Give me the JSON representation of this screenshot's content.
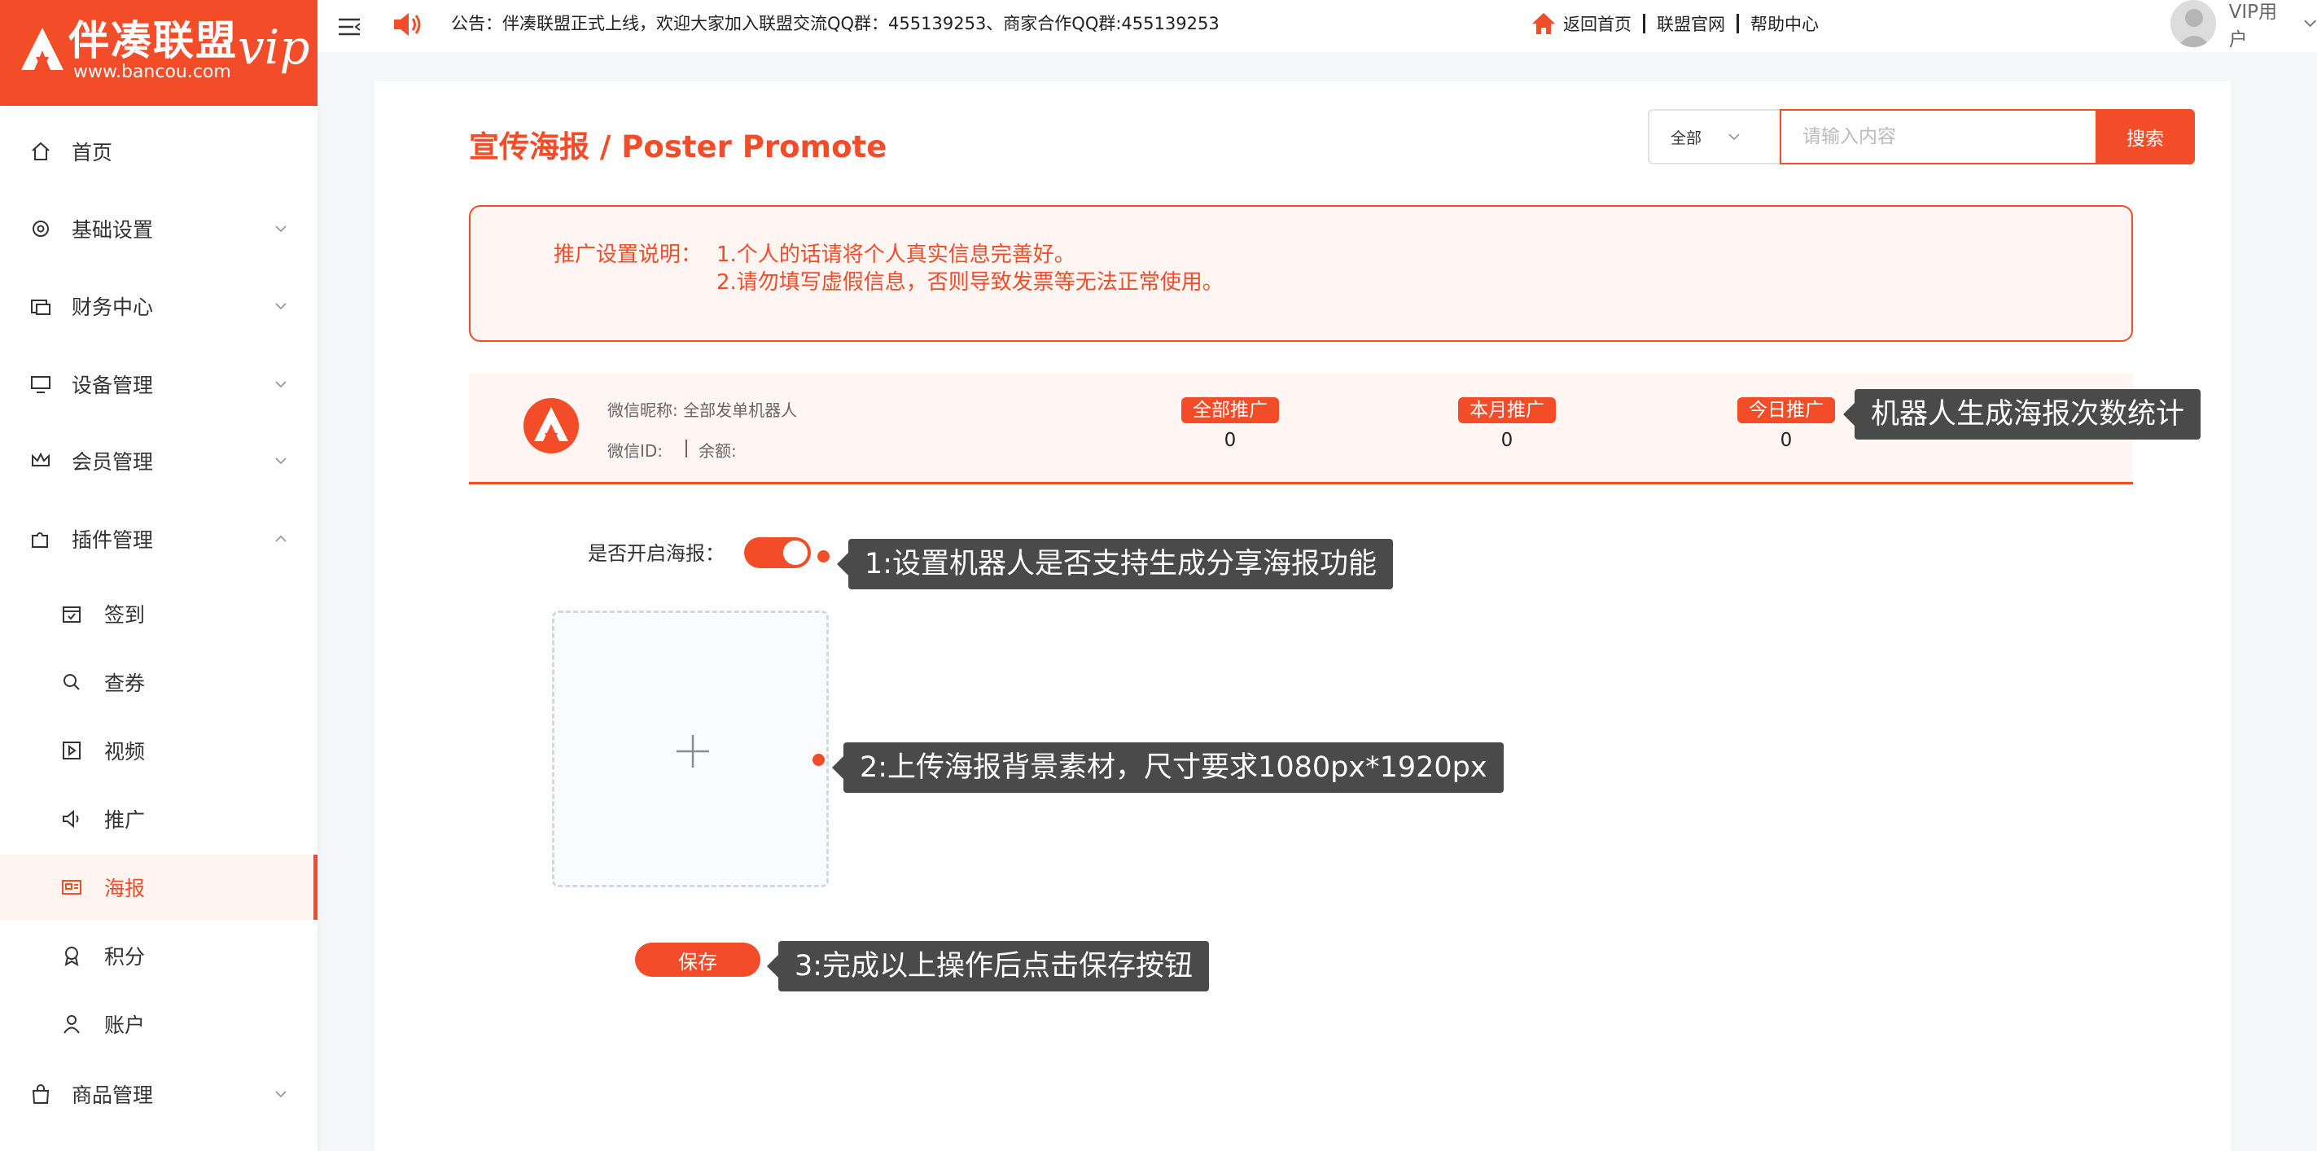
{
  "brand": {
    "name_cn": "伴凑联盟",
    "url": "www.bancou.com",
    "vip": "vip"
  },
  "sidebar": {
    "items": [
      {
        "label": "首页",
        "icon": "home-icon"
      },
      {
        "label": "基础设置",
        "icon": "gear-icon"
      },
      {
        "label": "财务中心",
        "icon": "finance-icon"
      },
      {
        "label": "设备管理",
        "icon": "monitor-icon"
      },
      {
        "label": "会员管理",
        "icon": "crown-icon"
      },
      {
        "label": "插件管理",
        "icon": "puzzle-icon"
      },
      {
        "label": "商品管理",
        "icon": "bag-icon"
      }
    ],
    "sub_items": [
      {
        "label": "签到",
        "icon": "calendar-icon"
      },
      {
        "label": "查券",
        "icon": "search-icon"
      },
      {
        "label": "视频",
        "icon": "video-icon"
      },
      {
        "label": "推广",
        "icon": "megaphone-icon"
      },
      {
        "label": "海报",
        "icon": "poster-icon",
        "active": true
      },
      {
        "label": "积分",
        "icon": "medal-icon"
      },
      {
        "label": "账户",
        "icon": "user-icon"
      }
    ]
  },
  "topbar": {
    "notice": "公告：伴凑联盟正式上线，欢迎大家加入联盟交流QQ群：455139253、商家合作QQ群:455139253",
    "links": [
      "返回首页",
      "联盟官网",
      "帮助中心"
    ],
    "user_name": "VIP用户"
  },
  "page": {
    "title": "宣传海报 / Poster Promote",
    "search": {
      "select_value": "全部",
      "placeholder": "请输入内容",
      "button": "搜索"
    },
    "notice_box": {
      "title": "推广设置说明：",
      "line1": "1.个人的话请将个人真实信息完善好。",
      "line2": "2.请勿填写虚假信息，否则导致发票等无法正常使用。"
    },
    "stats": {
      "nickname": "微信昵称: 全部发单机器人",
      "wechat_id": "微信ID:",
      "balance": "余额:",
      "columns": [
        {
          "label": "全部推广",
          "value": "0"
        },
        {
          "label": "本月推广",
          "value": "0"
        },
        {
          "label": "今日推广",
          "value": "0"
        }
      ]
    },
    "toggle_label": "是否开启海报：",
    "toggle_on": true,
    "save_button": "保存",
    "tips": {
      "stats": "机器人生成海报次数统计",
      "toggle": "1:设置机器人是否支持生成分享海报功能",
      "upload": "2:上传海报背景素材，尺寸要求1080px*1920px",
      "save": "3:完成以上操作后点击保存按钮"
    }
  },
  "colors": {
    "accent": "#f24c28",
    "tip_bg": "#4a4a4a",
    "light_accent_bg": "#fff6f4"
  }
}
